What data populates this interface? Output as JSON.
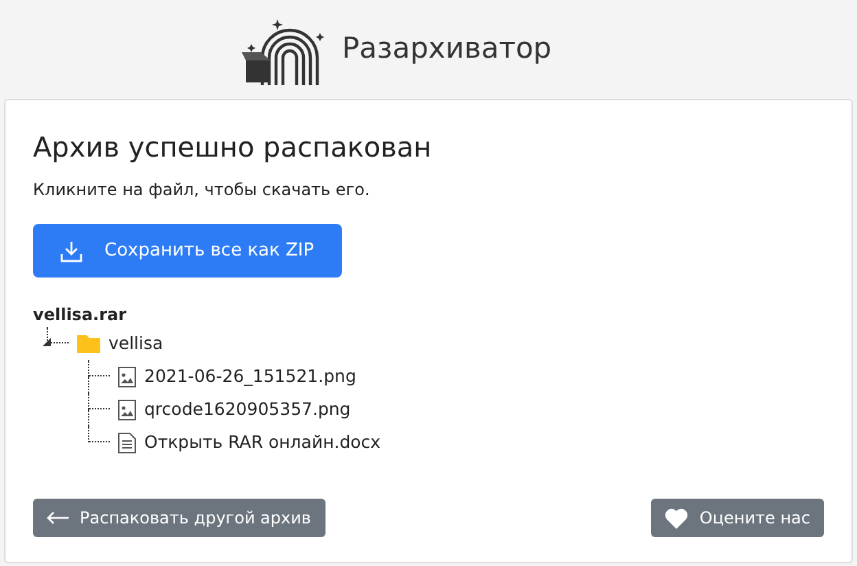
{
  "header": {
    "brand": "Разархиватор"
  },
  "card": {
    "title": "Архив успешно распакован",
    "subtitle": "Кликните на файл, чтобы скачать его.",
    "save_button": "Сохранить все как ZIP"
  },
  "tree": {
    "root": "vellisa.rar",
    "children": [
      {
        "kind": "folder",
        "name": "vellisa",
        "expanded": true,
        "children": [
          {
            "kind": "image",
            "name": "2021-06-26_151521.png"
          },
          {
            "kind": "image",
            "name": "qrcode1620905357.png"
          },
          {
            "kind": "document",
            "name": "Открыть RAR онлайн.docx"
          }
        ]
      }
    ]
  },
  "footer": {
    "back_button": "Распаковать другой архив",
    "rate_button": "Оцените нас"
  }
}
